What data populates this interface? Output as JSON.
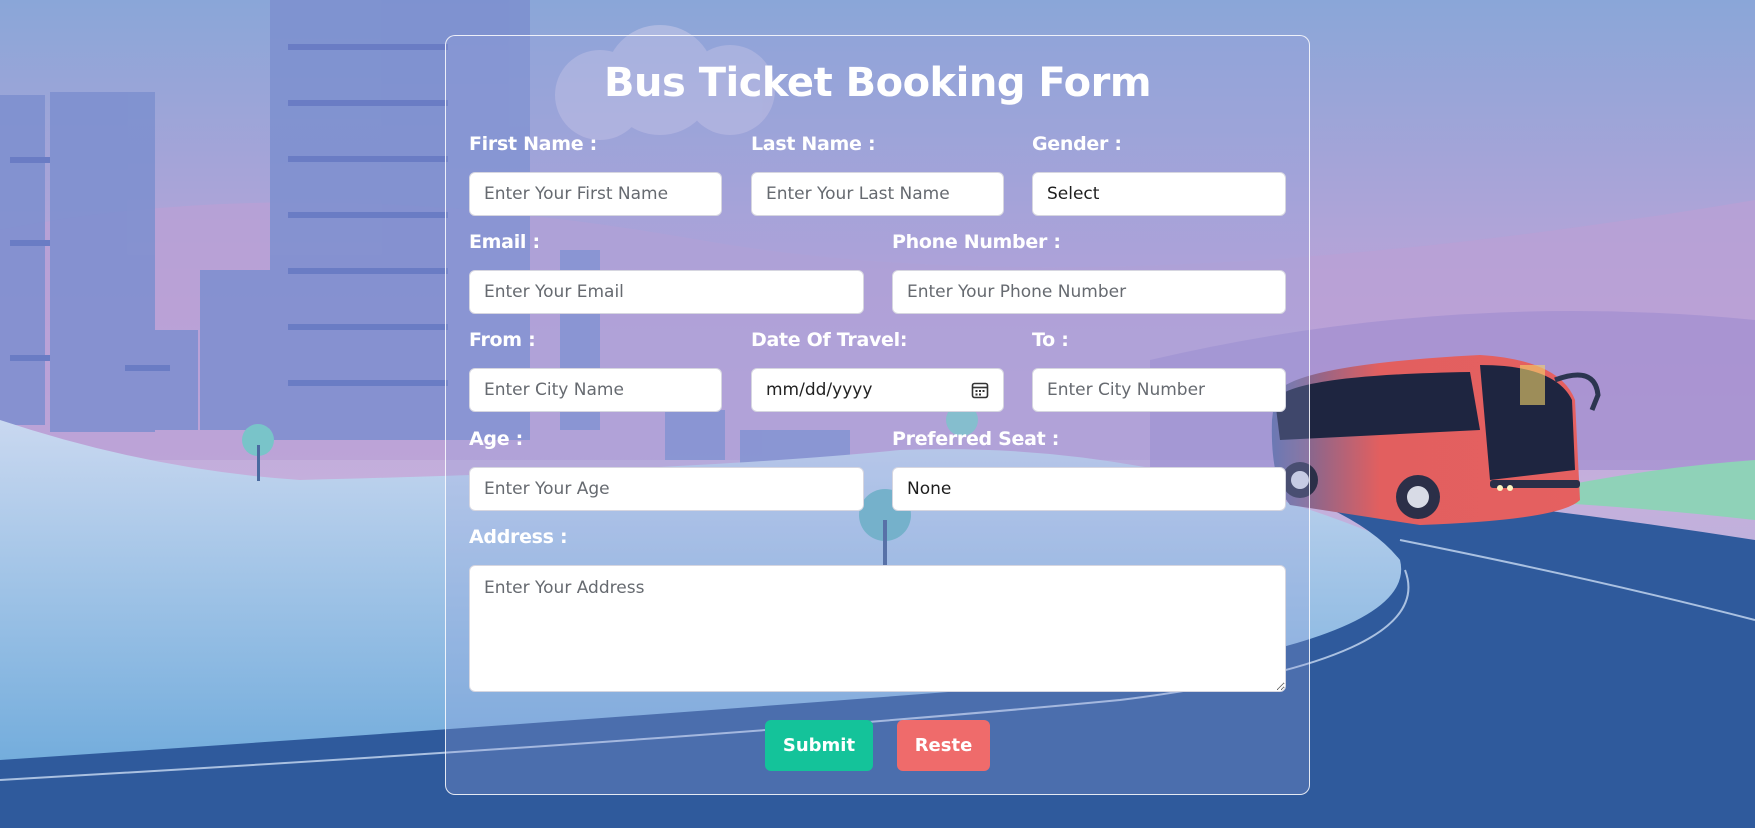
{
  "form": {
    "title": "Bus Ticket Booking Form",
    "first_name": {
      "label": "First Name :",
      "placeholder": "Enter Your First Name"
    },
    "last_name": {
      "label": "Last Name :",
      "placeholder": "Enter Your Last Name"
    },
    "gender": {
      "label": "Gender :",
      "value": "Select"
    },
    "email": {
      "label": "Email :",
      "placeholder": "Enter Your Email"
    },
    "phone": {
      "label": "Phone Number :",
      "placeholder": "Enter Your Phone Number"
    },
    "from": {
      "label": "From :",
      "placeholder": "Enter City Name"
    },
    "date_of_travel": {
      "label": "Date Of Travel:",
      "value": "mm/dd/yyyy",
      "icon": "calendar-icon"
    },
    "to": {
      "label": "To :",
      "placeholder": "Enter City Number"
    },
    "age": {
      "label": "Age :",
      "placeholder": "Enter Your Age"
    },
    "preferred_seat": {
      "label": "Preferred Seat :",
      "value": "None"
    },
    "address": {
      "label": "Address :",
      "placeholder": "Enter Your Address"
    },
    "submit_label": "Submit",
    "reset_label": "Reste"
  },
  "colors": {
    "submit": "#14c39a",
    "reset": "#ef6b6b",
    "bus": "#e25f5f"
  }
}
